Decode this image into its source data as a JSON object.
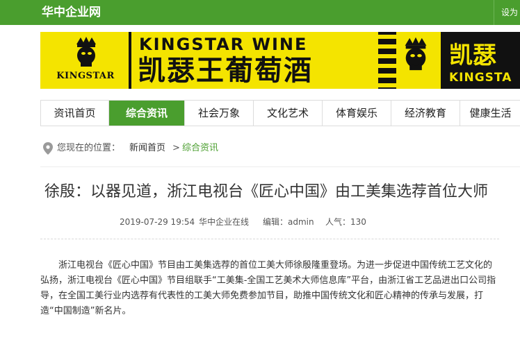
{
  "header": {
    "site_title": "华中企业网",
    "top_link": "设为"
  },
  "banner": {
    "logo_text": "KINGSTAR",
    "english_name": "KINGSTAR WINE",
    "chinese_name": "凯瑟王葡萄酒",
    "chinese_name_repeat": "凯瑟",
    "english_name_repeat": "KINGSTA",
    "colors": {
      "yellow": "#f4e400",
      "black": "#111111"
    }
  },
  "nav": {
    "items": [
      {
        "label": "资讯首页"
      },
      {
        "label": "综合资讯",
        "active": true
      },
      {
        "label": "社会万象"
      },
      {
        "label": "文化艺术"
      },
      {
        "label": "体育娱乐"
      },
      {
        "label": "经济教育"
      },
      {
        "label": "健康生活"
      }
    ],
    "active_color": "#4a9e2e"
  },
  "breadcrumb": {
    "prefix": "您现在的位置：",
    "home": "新闻首页",
    "separator": ">",
    "current": "综合资讯"
  },
  "article": {
    "title": "徐殷：以器见道，浙江电视台《匠心中国》由工美集选荐首位大师",
    "date": "2019-07-29 19:54",
    "source": "华中企业在线",
    "editor": "编辑：admin",
    "views": "人气：130",
    "body": "浙江电视台《匠心中国》节目由工美集选荐的首位工美大师徐殷隆重登场。为进一步促进中国传统工艺文化的弘扬，浙江电视台《匠心中国》节目组联手“工美集-全国工艺美术大师信息库”平台，由浙江省工艺品进出口公司指导，在全国工美行业内选荐有代表性的工美大师免费参加节目，助推中国传统文化和匠心精神的传承与发展，打造“中国制造”新名片。"
  }
}
